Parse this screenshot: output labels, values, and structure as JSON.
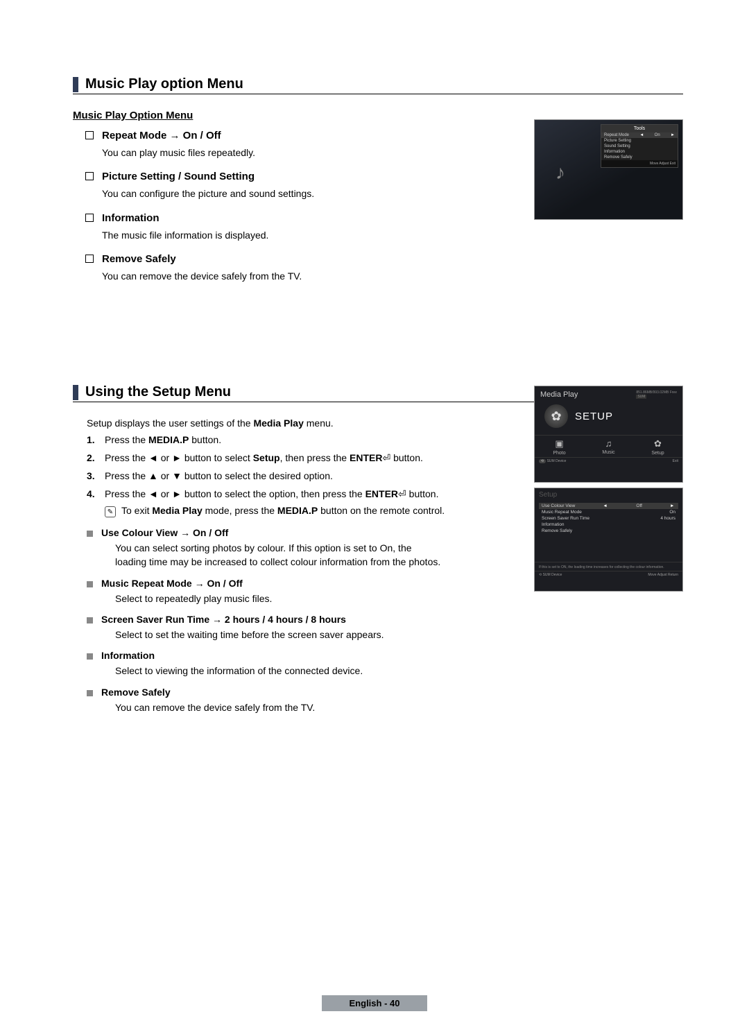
{
  "section1": {
    "title": "Music Play option Menu",
    "subheading": "Music Play Option Menu",
    "items": [
      {
        "title": "Repeat Mode → On / Off",
        "desc": "You can play music files repeatedly."
      },
      {
        "title": "Picture Setting / Sound Setting",
        "desc": "You can configure the picture and sound settings."
      },
      {
        "title": "Information",
        "desc": "The music file information is displayed."
      },
      {
        "title": "Remove Safely",
        "desc": "You can remove the device safely from the TV."
      }
    ]
  },
  "screenshot1": {
    "tools_header": "Tools",
    "rows": [
      {
        "label": "Repeat Mode",
        "value": "On",
        "selected": true
      },
      {
        "label": "Picture Setting",
        "value": ""
      },
      {
        "label": "Sound Setting",
        "value": ""
      },
      {
        "label": "Information",
        "value": ""
      },
      {
        "label": "Remove Safely",
        "value": ""
      }
    ],
    "footer": "Move   Adjust   Exit"
  },
  "section2": {
    "title": "Using the Setup Menu",
    "intro_pre": "Setup displays the user settings of the ",
    "intro_bold": "Media Play",
    "intro_post": " menu.",
    "steps": [
      {
        "n": "1.",
        "pre": "Press the ",
        "b1": "MEDIA.P",
        "post": " button."
      },
      {
        "n": "2.",
        "pre": "Press the ◄ or ► button to select ",
        "b1": "Setup",
        "mid": ", then press the ",
        "b2": "ENTER",
        "post": " button.",
        "enter": true
      },
      {
        "n": "3.",
        "pre": "Press the ▲ or ▼ button to select the desired option.",
        "b1": "",
        "post": ""
      },
      {
        "n": "4.",
        "pre": "Press the ◄ or ► button to select the option, then press the ",
        "b1": "ENTER",
        "post": " button.",
        "enter": true
      }
    ],
    "note_pre": "To exit ",
    "note_b1": "Media Play",
    "note_mid": " mode, press the ",
    "note_b2": "MEDIA.P",
    "note_post": " button on the remote control.",
    "options": [
      {
        "title": "Use Colour View → On / Off",
        "desc": "You can select sorting photos by colour. If this option is set to On, the loading time may be increased to collect colour information from the photos."
      },
      {
        "title": "Music Repeat Mode → On / Off",
        "desc": "Select to repeatedly play music files."
      },
      {
        "title": "Screen Saver Run Time → 2 hours / 4 hours / 8 hours",
        "desc": "Select to set the waiting time before the screen saver appears."
      },
      {
        "title": "Information",
        "desc": "Select to viewing the information of the connected device."
      },
      {
        "title": "Remove Safely",
        "desc": "You can remove the device safely from the TV."
      }
    ]
  },
  "screenshot2": {
    "title": "Media Play",
    "storage": "851.86MB/993.02MB Free",
    "sum": "SUM",
    "setup": "SETUP",
    "tabs": [
      {
        "icon": "▣",
        "label": "Photo"
      },
      {
        "icon": "♫",
        "label": "Music"
      },
      {
        "icon": "✿",
        "label": "Setup"
      }
    ],
    "foot_left": "SUM   Device",
    "foot_right": "Exit"
  },
  "screenshot3": {
    "header": "Setup",
    "rows": [
      {
        "label": "Use Colour View",
        "value": "Off",
        "selected": true
      },
      {
        "label": "Music Repeat Mode",
        "value": "On"
      },
      {
        "label": "Screen Saver Run Time",
        "value": "4 hours"
      },
      {
        "label": "Information",
        "value": ""
      },
      {
        "label": "Remove Safely",
        "value": ""
      }
    ],
    "hint": "If this is set to ON, the loading time increases for collecting the colour information.",
    "foot_left": "SUM   Device",
    "foot_right": "Move   Adjust   Return"
  },
  "footer": "English - 40"
}
